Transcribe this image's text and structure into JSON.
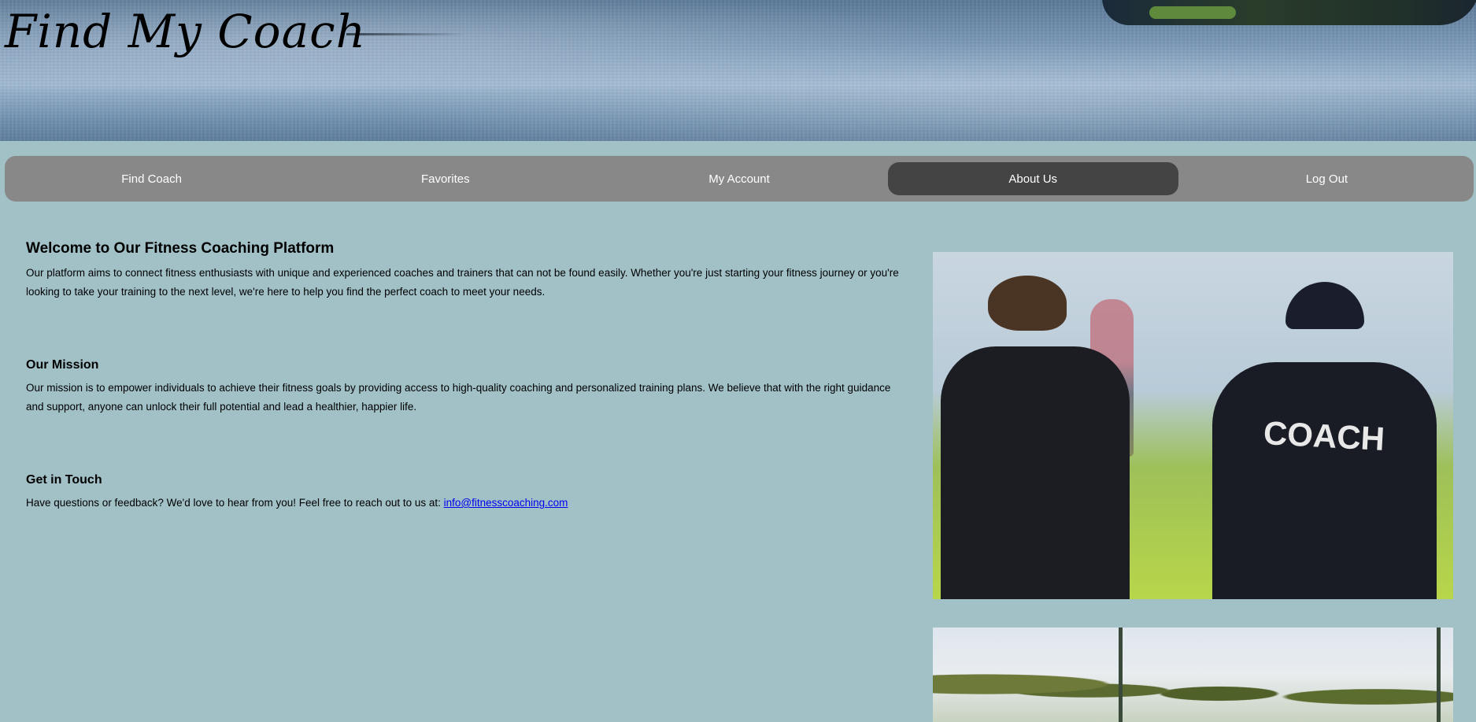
{
  "header": {
    "brand": "Find My Coach"
  },
  "nav": {
    "items": [
      {
        "label": "Find Coach"
      },
      {
        "label": "Favorites"
      },
      {
        "label": "My Account"
      },
      {
        "label": "About Us",
        "active": true
      },
      {
        "label": "Log Out"
      }
    ]
  },
  "main": {
    "welcome": {
      "heading": "Welcome to Our Fitness Coaching Platform",
      "body": "Our platform aims to connect fitness enthusiasts with unique and experienced coaches and trainers that can not be found easily. Whether you're just starting your fitness journey or you're looking to take your training to the next level, we're here to help you find the perfect coach to meet your needs."
    },
    "mission": {
      "heading": "Our Mission",
      "body": "Our mission is to empower individuals to achieve their fitness goals by providing access to high-quality coaching and personalized training plans. We believe that with the right guidance and support, anyone can unlock their full potential and lead a healthier, happier life."
    },
    "contact": {
      "heading": "Get in Touch",
      "body": "Have questions or feedback? We'd love to hear from you! Feel free to reach out to us at: ",
      "email": "info@fitnesscoaching.com"
    }
  },
  "images": {
    "photo1_jersey_text": "COACH"
  },
  "colors": {
    "page_background": "#a1c1c7",
    "nav_background": "#888888",
    "nav_active": "#444444",
    "link": "#0000ee"
  }
}
